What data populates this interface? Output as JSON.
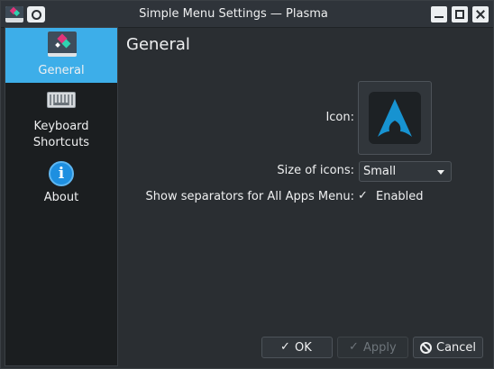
{
  "window": {
    "title": "Simple Menu Settings — Plasma",
    "app_icon": "plasma-menu-icon",
    "pin_icon": "pin-icon",
    "controls": [
      "minimize-icon",
      "maximize-icon",
      "close-icon"
    ]
  },
  "sidebar": {
    "items": [
      {
        "label": "General",
        "icon": "general-settings-icon",
        "active": true
      },
      {
        "label": "Keyboard\nShortcuts",
        "icon": "keyboard-icon",
        "active": false
      },
      {
        "label": "About",
        "icon": "info-icon",
        "active": false
      }
    ]
  },
  "main": {
    "title": "General",
    "icon_label": "Icon:",
    "icon_value": "arch-linux-logo-icon",
    "size_label": "Size of icons:",
    "size_value": "Small",
    "separators_label": "Show separators for All Apps Menu:",
    "separators_checked": true,
    "separators_check_glyph": "✓",
    "separators_text": "Enabled"
  },
  "buttons": {
    "ok_glyph": "✓",
    "ok_label": "OK",
    "apply_glyph": "✓",
    "apply_label": "Apply",
    "cancel_label": "Cancel"
  },
  "colors": {
    "accent": "#3daee9",
    "window_bg": "#2a2e32",
    "sidebar_bg": "#1b1e20",
    "arch_blue": "#1793d1"
  }
}
